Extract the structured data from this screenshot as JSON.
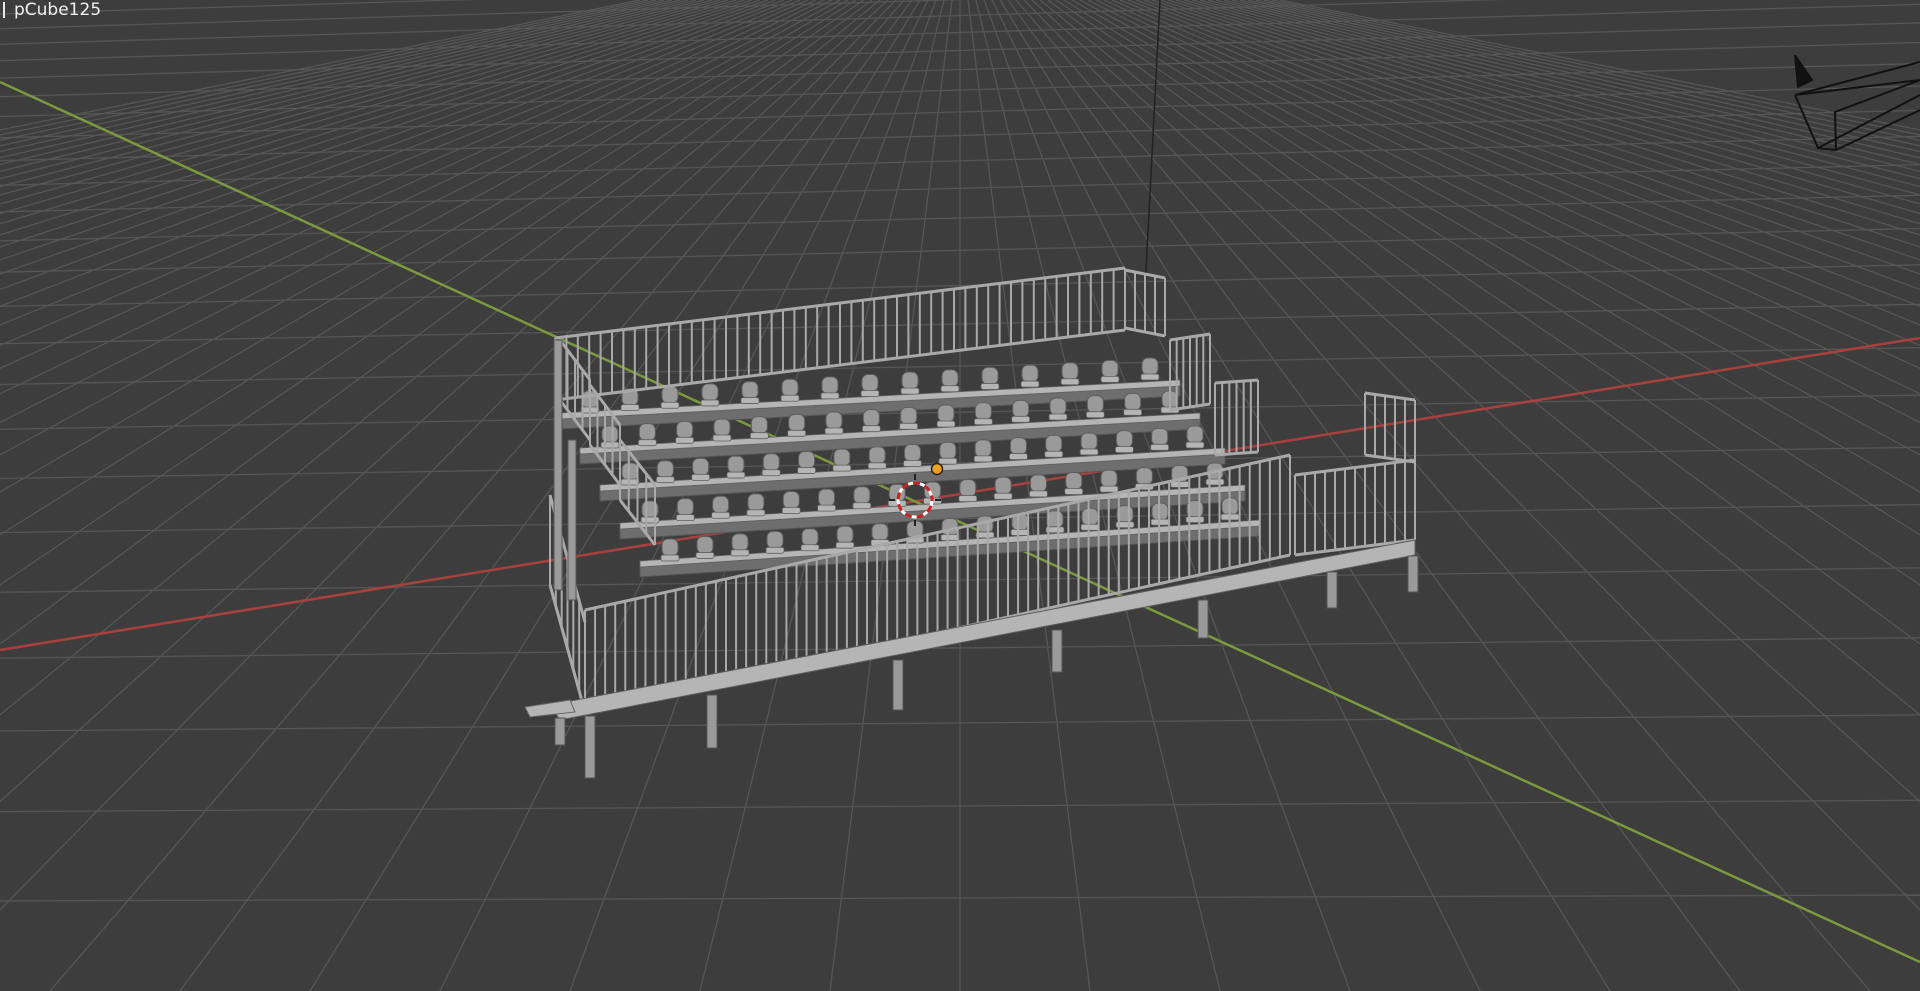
{
  "viewport": {
    "active_object": "pCube125",
    "background_color": "#3d3d3d",
    "grid_color": "#555555",
    "x_axis_color": "#a8403f",
    "y_axis_color": "#7a9a3d",
    "model_color": "#9a9a9a",
    "origin_color": "#f0a020"
  },
  "icons": {
    "camera": "camera-icon",
    "cursor": "3d-cursor-icon",
    "origin": "object-origin-icon"
  }
}
